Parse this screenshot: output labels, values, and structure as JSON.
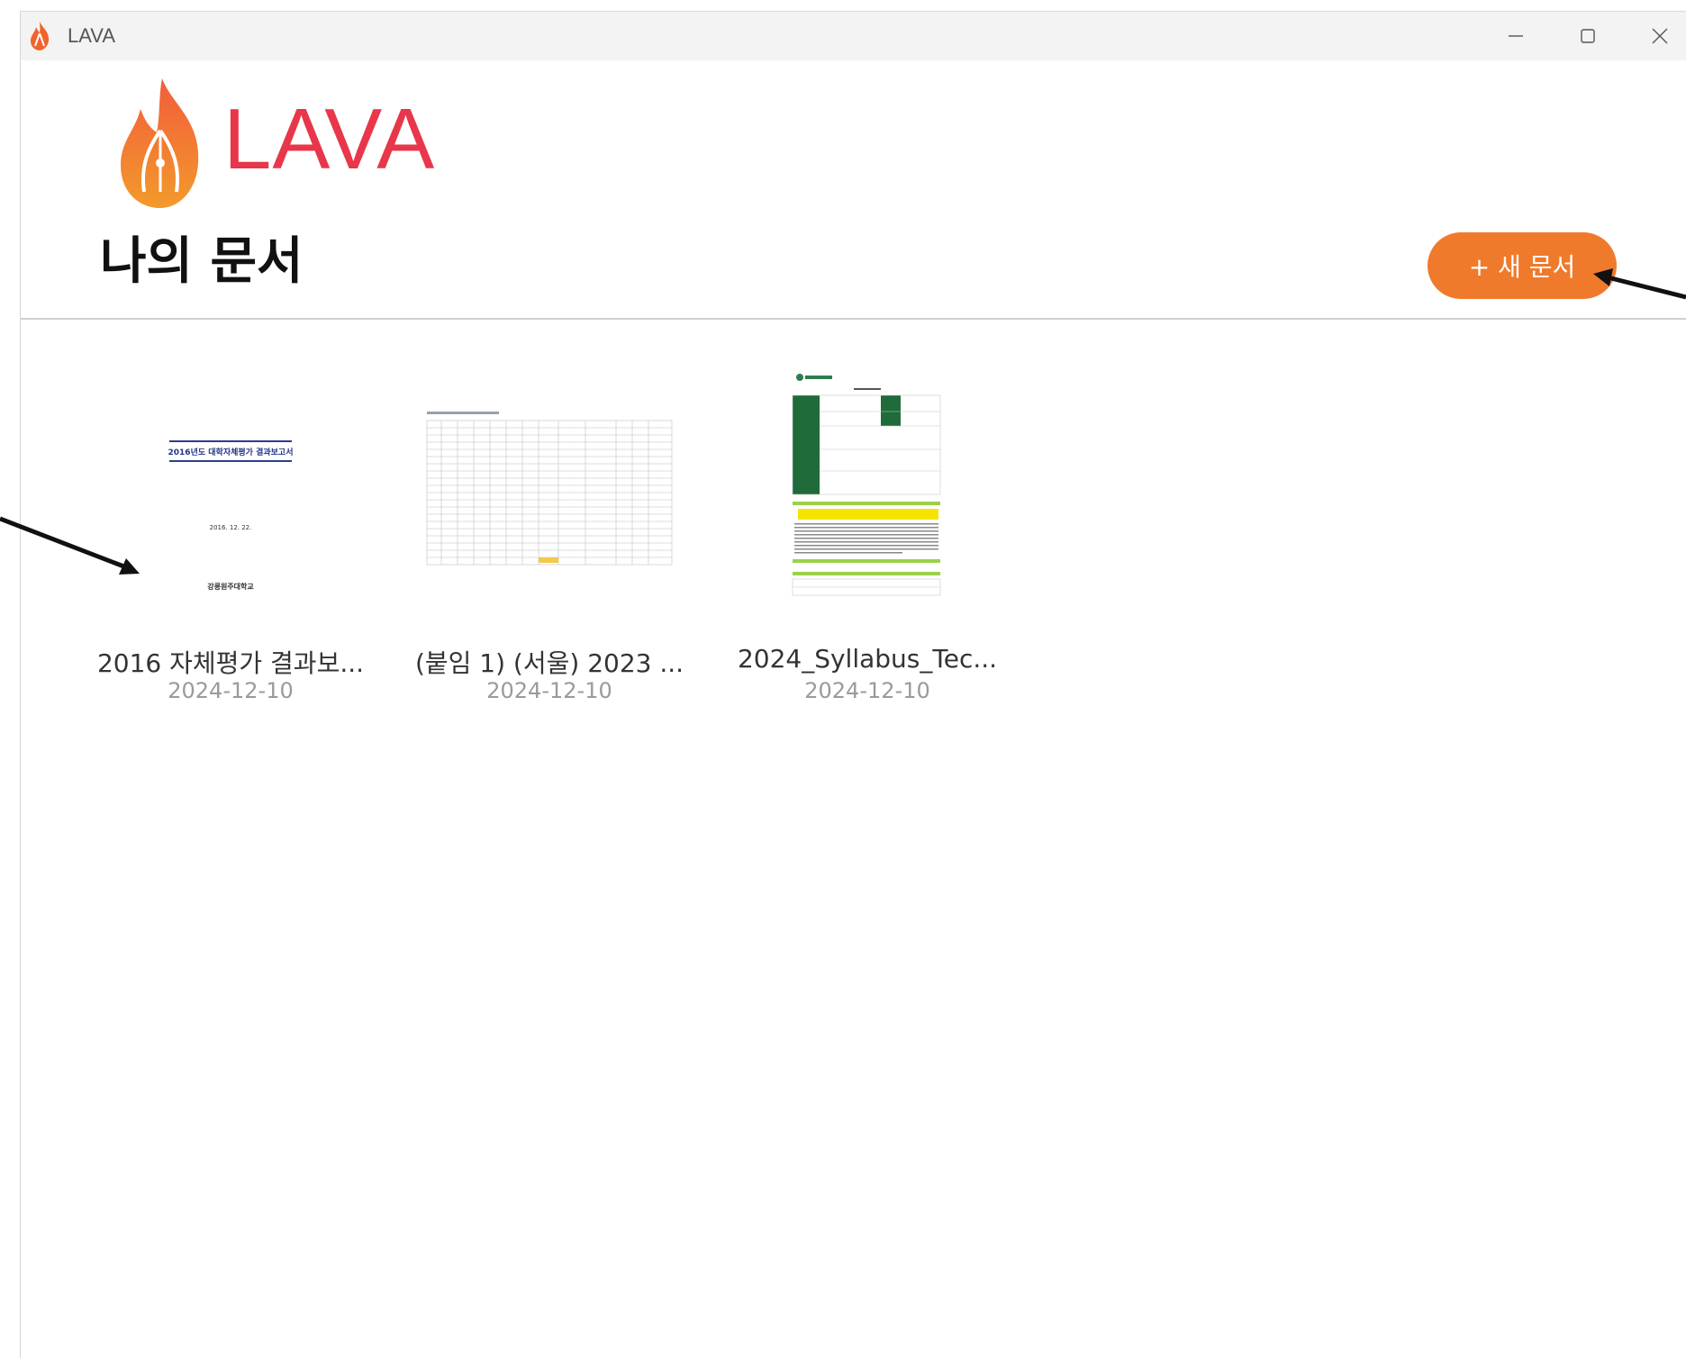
{
  "window": {
    "title": "LAVA",
    "controls": [
      "minimize",
      "maximize",
      "close"
    ]
  },
  "brand": {
    "name": "LAVA",
    "color": "#e8374a",
    "accent": "#f07a2c"
  },
  "header": {
    "page_title": "나의 문서",
    "new_button_label": "+ 새 문서"
  },
  "documents": [
    {
      "name": "2016 자체평가 결과보...",
      "date": "2024-12-10",
      "thumb_title": "2016년도 대학자체평가 결과보고서",
      "thumb_date": "2016. 12. 22.",
      "thumb_org": "강릉원주대학교"
    },
    {
      "name": "(붙임 1) (서울) 2023 ...",
      "date": "2024-12-10"
    },
    {
      "name": "2024_Syllabus_Tec...",
      "date": "2024-12-10"
    }
  ]
}
